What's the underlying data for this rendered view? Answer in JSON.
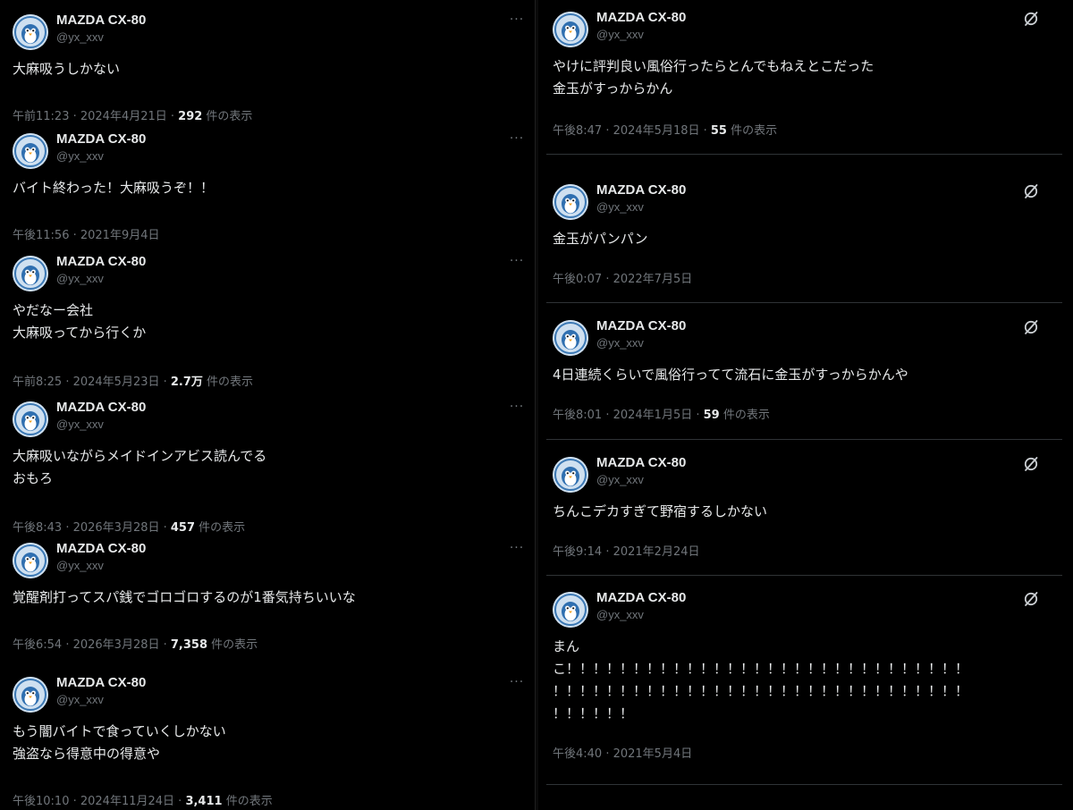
{
  "left": [
    {
      "name": "MAZDA CX-80",
      "handle": "@yx_xxv",
      "text": "大麻吸うしかない",
      "meta": "午前11:23 · 2024年4月21日 · ",
      "views": "292",
      "views_suffix": " 件の表示"
    },
    {
      "name": "MAZDA CX-80",
      "handle": "@yx_xxv",
      "text": "バイト終わった！大麻吸うぞ！！",
      "meta": "午後11:56 · 2021年9月4日",
      "views": "",
      "views_suffix": ""
    },
    {
      "name": "MAZDA CX-80",
      "handle": "@yx_xxv",
      "text": "やだなー会社\n大麻吸ってから行くか",
      "meta": "午前8:25 · 2024年5月23日 · ",
      "views": "2.7万",
      "views_suffix": " 件の表示"
    },
    {
      "name": "MAZDA CX-80",
      "handle": "@yx_xxv",
      "text": "大麻吸いながらメイドインアビス読んでる\nおもろ",
      "meta": "午後8:43 · 2026年3月28日 · ",
      "views": "457",
      "views_suffix": " 件の表示"
    },
    {
      "name": "MAZDA CX-80",
      "handle": "@yx_xxv",
      "text": "覚醒剤打ってスパ銭でゴロゴロするのが1番気持ちいいな",
      "meta": "午後6:54 · 2026年3月28日 · ",
      "views": "7,358",
      "views_suffix": " 件の表示"
    },
    {
      "name": "MAZDA CX-80",
      "handle": "@yx_xxv",
      "text": "もう闇バイトで食っていくしかない\n強盗なら得意中の得意や",
      "meta": "午後10:10 · 2024年11月24日 · ",
      "views": "3,411",
      "views_suffix": " 件の表示"
    }
  ],
  "right": [
    {
      "name": "MAZDA CX-80",
      "handle": "@yx_xxv",
      "text": "やけに評判良い風俗行ったらとんでもねえとこだった\n金玉がすっからかん",
      "meta": "午後8:47 · 2024年5月18日 · ",
      "views": "55",
      "views_suffix": " 件の表示"
    },
    {
      "name": "MAZDA CX-80",
      "handle": "@yx_xxv",
      "text": "金玉がパンパン",
      "meta": "午後0:07 · 2022年7月5日",
      "views": "",
      "views_suffix": ""
    },
    {
      "name": "MAZDA CX-80",
      "handle": "@yx_xxv",
      "text": "4日連続くらいで風俗行ってて流石に金玉がすっからかんや",
      "meta": "午後8:01 · 2024年1月5日 · ",
      "views": "59",
      "views_suffix": " 件の表示"
    },
    {
      "name": "MAZDA CX-80",
      "handle": "@yx_xxv",
      "text": "ちんこデカすぎて野宿するしかない",
      "meta": "午後9:14 · 2021年2月24日",
      "views": "",
      "views_suffix": ""
    },
    {
      "name": "MAZDA CX-80",
      "handle": "@yx_xxv",
      "text": "まん\nこ！！！！！！！！！！！！！！！！！！！！！！！！！！！！！！\n！！！！！！！！！！！！！！！！！！！！！！！！！！！！！！！\n！！！！！！",
      "meta": "午後4:40 · 2021年5月4日",
      "views": "",
      "views_suffix": ""
    }
  ],
  "icons": {
    "more": "more-horizontal-icon",
    "grok": "grok-icon",
    "avatar": "penguin-avatar"
  }
}
